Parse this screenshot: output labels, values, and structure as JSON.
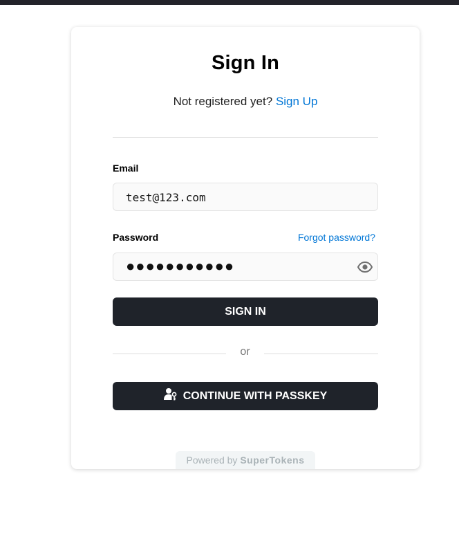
{
  "card": {
    "title": "Sign In",
    "subtitle_prefix": "Not registered yet?",
    "signup_link": "Sign Up",
    "email_label": "Email",
    "email_value": "test@123.com",
    "password_label": "Password",
    "forgot_link": "Forgot password?",
    "password_mask": "●●●●●●●●●●●",
    "signin_button": "SIGN IN",
    "or_text": "or",
    "passkey_button": "CONTINUE WITH PASSKEY",
    "powered_prefix": "Powered by",
    "powered_brand": "SuperTokens"
  },
  "colors": {
    "link": "#0076d6",
    "button_bg": "#1f232a",
    "topbar": "#23232a"
  },
  "icons": {
    "password_toggle": "eye-icon",
    "passkey": "passkey-user-icon"
  }
}
